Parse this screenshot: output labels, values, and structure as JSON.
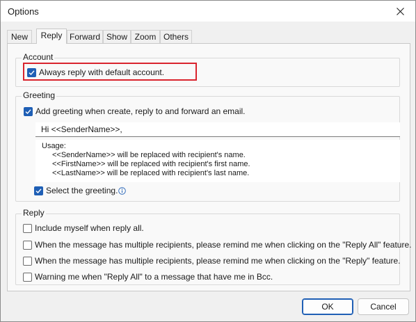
{
  "window": {
    "title": "Options"
  },
  "tabs": [
    {
      "label": "New"
    },
    {
      "label": "Reply"
    },
    {
      "label": "Forward"
    },
    {
      "label": "Show"
    },
    {
      "label": "Zoom"
    },
    {
      "label": "Others"
    }
  ],
  "active_tab": "Reply",
  "account": {
    "group_label": "Account",
    "always_reply_default": {
      "label": "Always reply with default account.",
      "checked": true
    }
  },
  "greeting": {
    "group_label": "Greeting",
    "add_greeting": {
      "label": "Add greeting when create, reply to and forward an email.",
      "checked": true
    },
    "input_value": "Hi <<SenderName>>,",
    "usage_title": "Usage:",
    "usage_lines": [
      "<<SenderName>> will be replaced with recipient's name.",
      "<<FirstName>> will be replaced with recipient's first name.",
      "<<LastName>> will be replaced with recipient's last name."
    ],
    "select_greeting": {
      "label": "Select the greeting.",
      "checked": true
    }
  },
  "reply": {
    "group_label": "Reply",
    "options": [
      {
        "label": "Include myself when reply all.",
        "checked": false
      },
      {
        "label": "When the message has multiple recipients, please remind me when clicking on the \"Reply All\" feature.",
        "checked": false
      },
      {
        "label": "When the message has multiple recipients, please remind me when clicking on the \"Reply\" feature.",
        "checked": false
      },
      {
        "label": "Warning me when \"Reply All\" to a message that have me in Bcc.",
        "checked": false
      }
    ]
  },
  "buttons": {
    "ok": "OK",
    "cancel": "Cancel"
  },
  "colors": {
    "accent": "#1f5fb5",
    "highlight": "#d9232d"
  }
}
